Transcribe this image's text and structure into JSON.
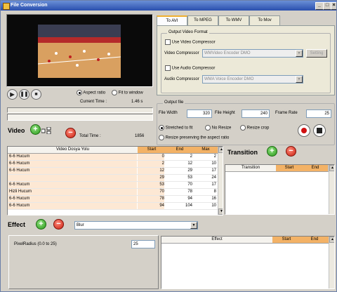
{
  "window": {
    "title": "File Conversion"
  },
  "tabs": [
    "To AVI",
    "To MPEG",
    "To WMV",
    "To Mov"
  ],
  "output_video_format": {
    "group_title": "Output Video Format",
    "use_video_compressor": "Use Video Compressor",
    "video_compressor_label": "Video Compressor",
    "video_compressor_value": "WMVideo Encoder DMO",
    "setting_label": "Setting",
    "use_audio_compressor": "Use Audio Compressor",
    "audio_compressor_label": "Audio Compressor",
    "audio_compressor_value": "WMA Voice Encoder DMO"
  },
  "output_file": {
    "group_title": "Output file",
    "file_width_label": "File Width",
    "file_width": "320",
    "file_height_label": "File Height",
    "file_height": "240",
    "frame_rate_label": "Frame Rate",
    "frame_rate": "25",
    "opt_stretched": "Stretched to fit",
    "opt_no_resize": "No Resize",
    "opt_resize_crop": "Resize crop",
    "opt_preserve": "Resize preserving the aspect ratio"
  },
  "player": {
    "aspect_ratio": "Aspect ratio",
    "fit_to_window": "Fit to window",
    "current_time_label": "Current Time :",
    "current_time": "1.46 s"
  },
  "video": {
    "label": "Video",
    "total_time_label": "Total Time :",
    "total_time": "1856",
    "columns": [
      "Video Dosya Yolu",
      "Start",
      "End",
      "Max"
    ],
    "rows": [
      [
        "6-6 Hucum",
        "0",
        "2",
        "2"
      ],
      [
        "6-6 Hucum",
        "2",
        "12",
        "10"
      ],
      [
        "6-6 Hucum",
        "12",
        "29",
        "17"
      ],
      [
        "",
        "29",
        "53",
        "24"
      ],
      [
        "6-6 Hucum",
        "53",
        "70",
        "17"
      ],
      [
        "Hizli Hucum",
        "70",
        "78",
        "8"
      ],
      [
        "6-6 Hucum",
        "78",
        "94",
        "16"
      ],
      [
        "6-6 Hucum",
        "94",
        "104",
        "10"
      ]
    ]
  },
  "transition": {
    "label": "Transition",
    "columns": [
      "Transition",
      "Start",
      "End"
    ]
  },
  "effect": {
    "label": "Effect",
    "selected": "Blur",
    "param_label": "PixelRadius (0.0 to 25)",
    "param_value": "25",
    "columns": [
      "Effect",
      "Start",
      "End"
    ]
  }
}
